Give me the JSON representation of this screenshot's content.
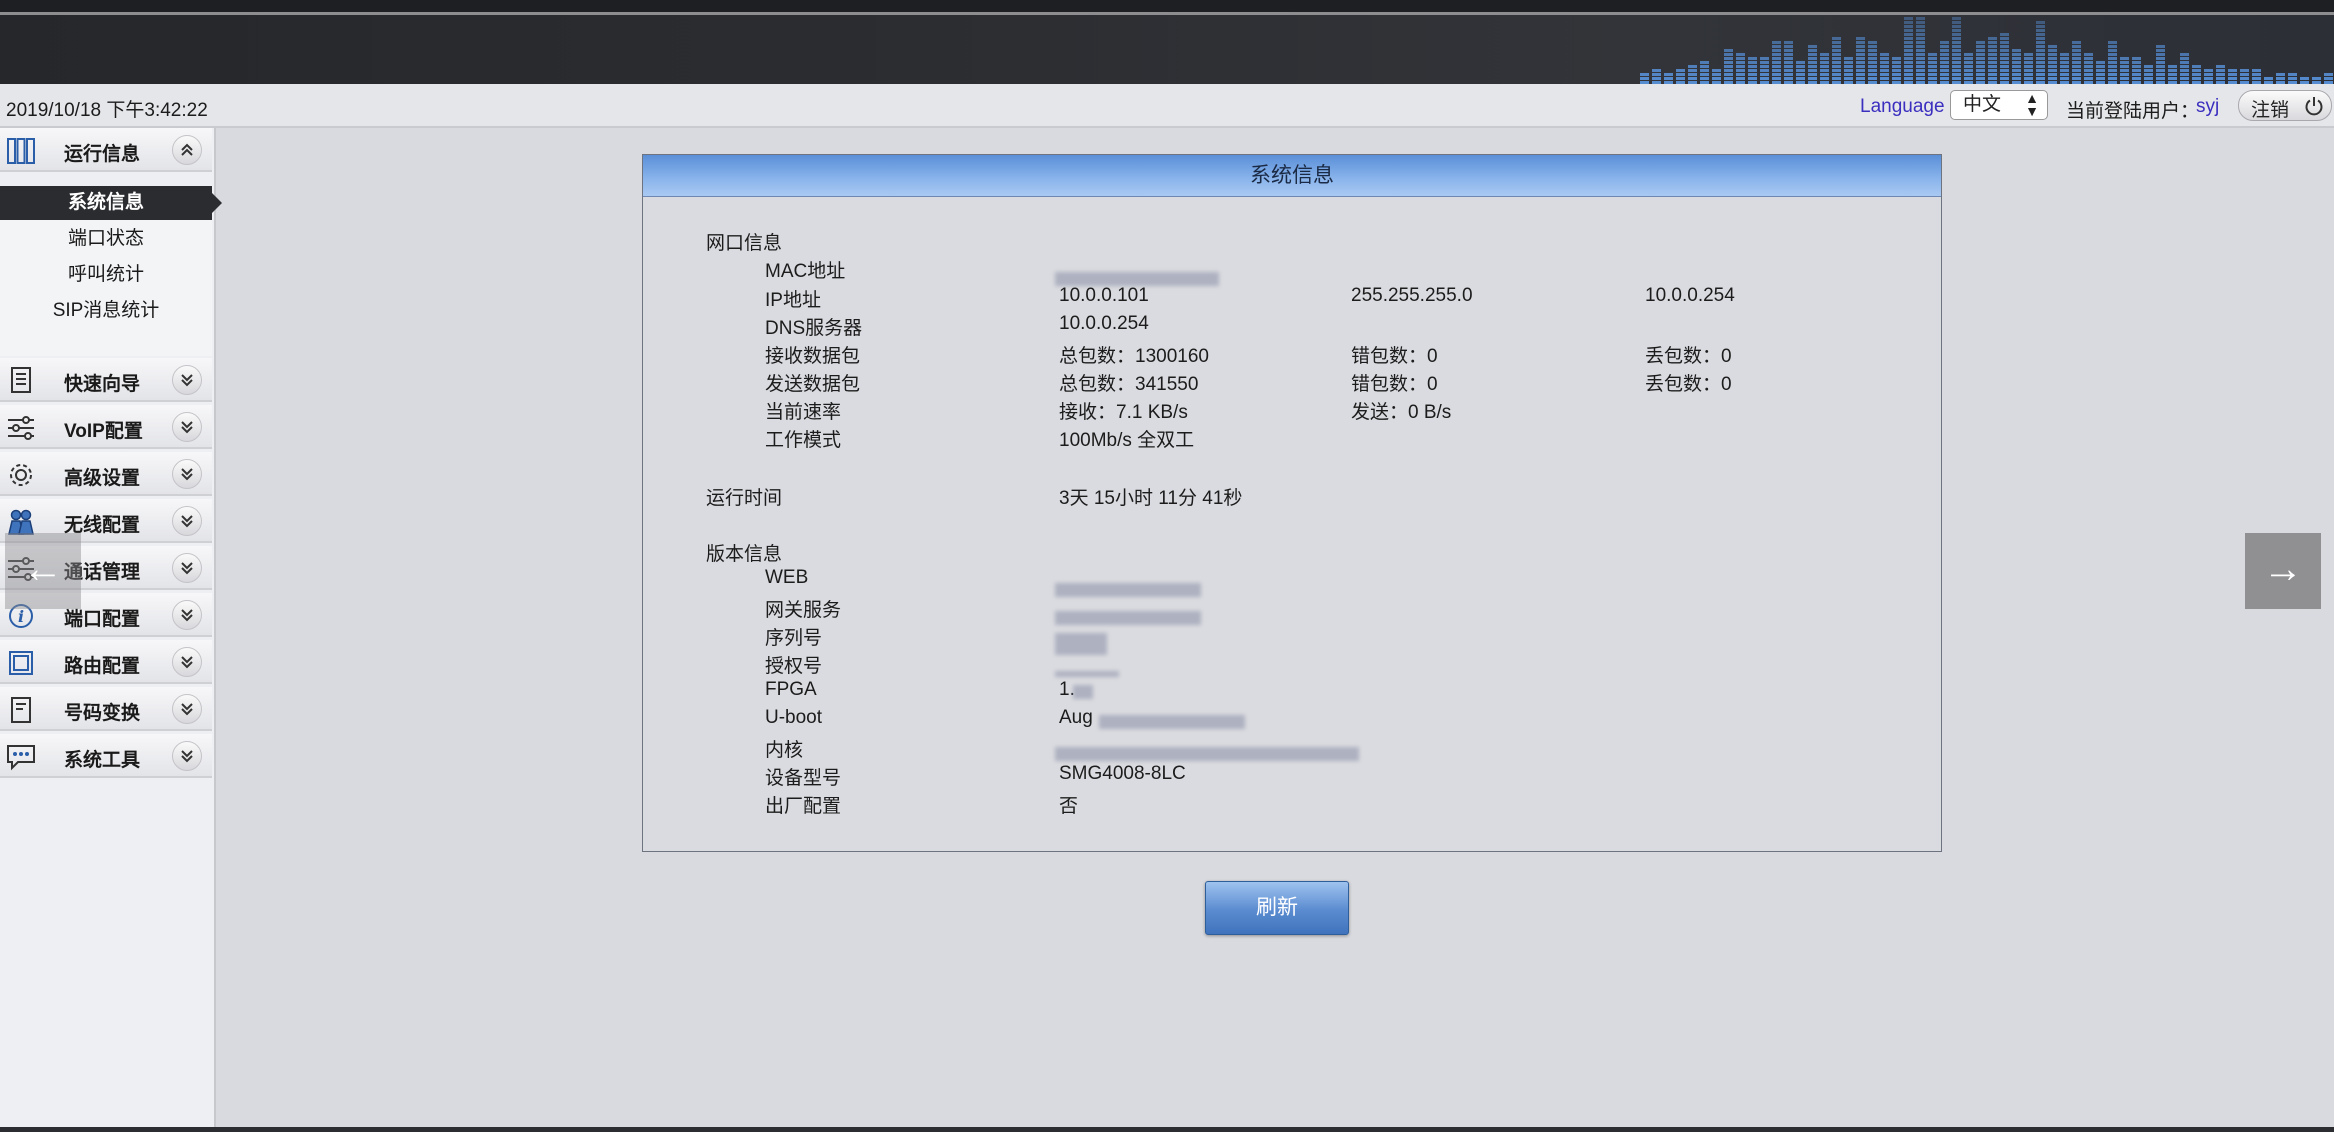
{
  "header": {
    "datetime": "2019/10/18 下午3:42:22",
    "language_label": "Language",
    "language_value": "中文",
    "user_label": "当前登陆用户：",
    "user_name": "syj",
    "logout_label": "注销"
  },
  "sidebar": {
    "sections": [
      {
        "label": "运行信息",
        "icon": "columns-icon",
        "expanded": true
      },
      {
        "label": "快速向导",
        "icon": "document-icon"
      },
      {
        "label": "VoIP配置",
        "icon": "sliders-icon"
      },
      {
        "label": "高级设置",
        "icon": "gear-icon"
      },
      {
        "label": "无线配置",
        "icon": "users-icon"
      },
      {
        "label": "通话管理",
        "icon": "sliders-icon"
      },
      {
        "label": "端口配置",
        "icon": "info-icon"
      },
      {
        "label": "路由配置",
        "icon": "square-icon"
      },
      {
        "label": "号码变换",
        "icon": "form-icon"
      },
      {
        "label": "系统工具",
        "icon": "chat-icon"
      }
    ],
    "submenu": [
      "系统信息",
      "端口状态",
      "呼叫统计",
      "SIP消息统计"
    ],
    "active_submenu": "系统信息"
  },
  "panel": {
    "title": "系统信息",
    "network": {
      "heading": "网口信息",
      "mac_label": "MAC地址",
      "ip_label": "IP地址",
      "ip": "10.0.0.101",
      "netmask": "255.255.255.0",
      "gateway": "10.0.0.254",
      "dns_label": "DNS服务器",
      "dns": "10.0.0.254",
      "rx_label": "接收数据包",
      "rx_total": "总包数：1300160",
      "rx_errors": "错包数：0",
      "rx_dropped": "丢包数：0",
      "tx_label": "发送数据包",
      "tx_total": "总包数：341550",
      "tx_errors": "错包数：0",
      "tx_dropped": "丢包数：0",
      "speed_label": "当前速率",
      "speed_rx": "接收：7.1 KB/s",
      "speed_tx": "发送：0 B/s",
      "mode_label": "工作模式",
      "mode": "100Mb/s 全双工"
    },
    "uptime": {
      "label": "运行时间",
      "value": "3天 15小时 11分 41秒"
    },
    "version": {
      "heading": "版本信息",
      "web_label": "WEB",
      "gateway_service_label": "网关服务",
      "serial_label": "序列号",
      "license_label": "授权号",
      "fpga_label": "FPGA",
      "fpga_value": "1.",
      "uboot_label": "U-boot",
      "uboot_value": "Aug",
      "kernel_label": "内核",
      "model_label": "设备型号",
      "model": "SMG4008-8LC",
      "factory_label": "出厂配置",
      "factory": "否"
    }
  },
  "buttons": {
    "refresh": "刷新",
    "prev_arrow": "←",
    "next_arrow": "→"
  }
}
